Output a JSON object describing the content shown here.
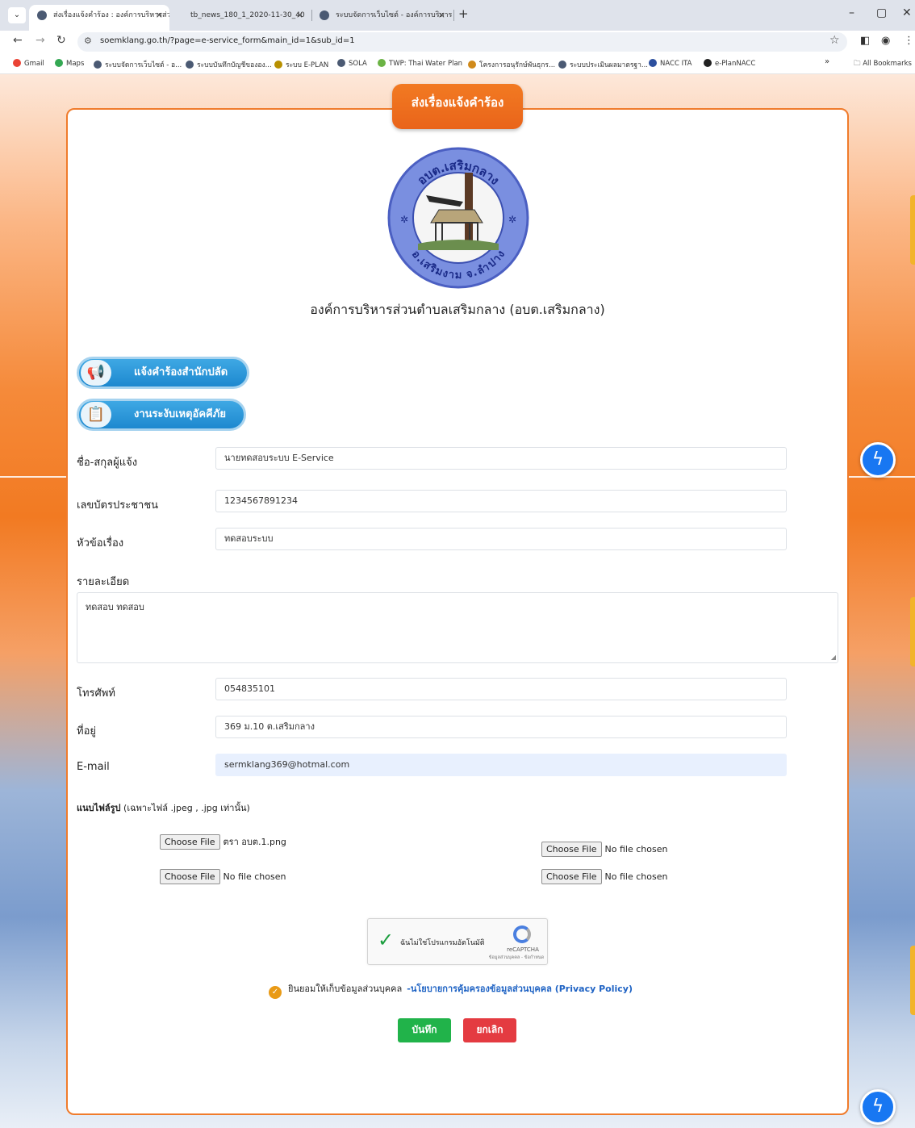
{
  "browser": {
    "tabs": [
      {
        "title": "ส่งเรื่องแจ้งคำร้อง : องค์การบริหารส่วน",
        "active": true
      },
      {
        "title": "tb_news_180_1_2020-11-30_40",
        "active": false
      },
      {
        "title": "ระบบจัดการเว็บไซต์ - องค์การบริหาร",
        "active": false
      }
    ],
    "close_glyph": "×",
    "new_tab_glyph": "+",
    "url": "soemklang.go.th/?page=e-service_form&main_id=1&sub_id=1",
    "bookmarks": [
      {
        "label": "Gmail",
        "color": "#ea4335"
      },
      {
        "label": "Maps",
        "color": "#34a853"
      },
      {
        "label": "ระบบจัดการเว็บไซต์ - อ...",
        "color": "#4b5a73"
      },
      {
        "label": "ระบบบันทึกบัญชีขององ...",
        "color": "#4b5a73"
      },
      {
        "label": "ระบบ E-PLAN",
        "color": "#b89000"
      },
      {
        "label": "SOLA",
        "color": "#4b5a73"
      },
      {
        "label": "TWP: Thai Water Plan",
        "color": "#6bb344"
      },
      {
        "label": "โครงการอนุรักษ์พันธุกร...",
        "color": "#d08a1b"
      },
      {
        "label": "ระบบประเมินผลมาตรฐา...",
        "color": "#4b5a73"
      },
      {
        "label": "NACC ITA",
        "color": "#2c4f9e"
      },
      {
        "label": "e-PlanNACC",
        "color": "#222222"
      }
    ],
    "more_bookmarks": "»",
    "all_bookmarks": "All Bookmarks"
  },
  "page": {
    "badge_title": "ส่งเรื่องแจ้งคำร้อง",
    "logo_text_top": "อบต.เสริมกลาง",
    "logo_text_bottom": "อ.เสริมงาม จ.ลำปาง",
    "org_name": "องค์การบริหารส่วนตำบลเสริมกลาง (อบต.เสริมกลาง)",
    "category_buttons": [
      {
        "label": "แจ้งคำร้องสำนักปลัด",
        "icon": "megaphone-icon"
      },
      {
        "label": "งานระงับเหตุอัคคีภัย",
        "icon": "clipboard-icon"
      }
    ],
    "form": {
      "name_label": "ชื่อ-สกุลผู้แจ้ง",
      "name_value": "นายทดสอบระบบ E-Service",
      "id_label": "เลขบัตรประชาชน",
      "id_value": "1234567891234",
      "subject_label": "หัวข้อเรื่อง",
      "subject_value": "ทดสอบระบบ",
      "detail_label": "รายละเอียด",
      "detail_value": "ทดสอบ ทดสอบ",
      "phone_label": "โทรศัพท์",
      "phone_value": "054835101",
      "address_label": "ที่อยู่",
      "address_value": "369 ม.10 ต.เสริมกลาง",
      "email_label": "E-mail",
      "email_value": "sermklang369@hotmal.com"
    },
    "attachments": {
      "title": "แนบไฟล์รูป",
      "hint": "(เฉพาะไฟล์ .jpeg , .jpg เท่านั้น)",
      "choose_label": "Choose File",
      "files": [
        "ตรา อบต.1.png",
        "No file chosen",
        "No file chosen",
        "No file chosen"
      ]
    },
    "captcha": {
      "text": "ฉันไม่ใช่โปรแกรมอัตโนมัติ",
      "brand": "reCAPTCHA",
      "terms": "ข้อมูลส่วนบุคคล - ข้อกำหนด"
    },
    "consent": {
      "text": "ยินยอมให้เก็บข้อมูลส่วนบุคคล",
      "policy_link": "-นโยบายการคุ้มครองข้อมูลส่วนบุคคล (Privacy Policy)"
    },
    "buttons": {
      "save": "บันทึก",
      "cancel": "ยกเลิก"
    }
  },
  "colors": {
    "accent": "#f27a22",
    "save": "#21b34a",
    "cancel": "#e43b41",
    "pill": "#1d88cf",
    "messenger": "#1877f2"
  }
}
